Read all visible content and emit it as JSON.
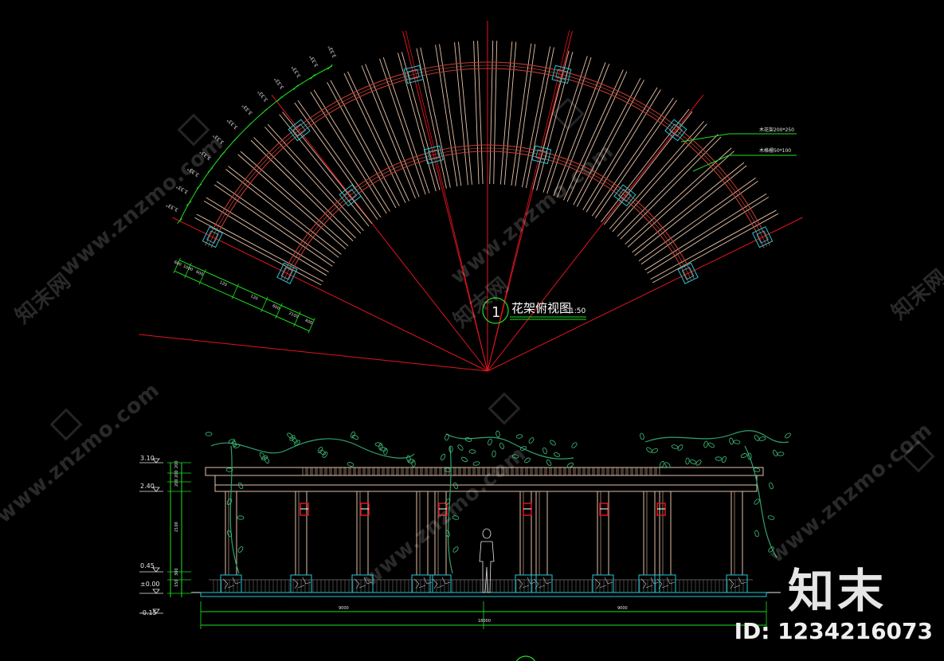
{
  "plan": {
    "title": "花架俯视图",
    "scale": "1:50",
    "index_number": "1",
    "callouts": [
      "木花架200*250",
      "木格栅50*100"
    ],
    "angle_labels": [
      "3.33°",
      "3.33°",
      "3.33°",
      "3.33°",
      "3.33°",
      "3.33°",
      "3.33°",
      "3.33°",
      "3.33°",
      "3.33°",
      "3.33°",
      "3.33°"
    ],
    "dims": [
      "400",
      "2100",
      "600",
      "120",
      "120",
      "600",
      "1000",
      "600"
    ]
  },
  "elevation": {
    "levels": [
      "3.10",
      "2.40",
      "0.45",
      "±0.00",
      "-0.15"
    ],
    "vert_dims": [
      "200",
      "200",
      "200",
      "2100",
      "300",
      "150"
    ],
    "horiz_dims": [
      "9000",
      "9000",
      "18000"
    ]
  },
  "watermark": {
    "text": "www.znzmo.com",
    "brand": "知末网"
  },
  "brand": {
    "name": "知末",
    "id": "ID: 1234216073"
  }
}
